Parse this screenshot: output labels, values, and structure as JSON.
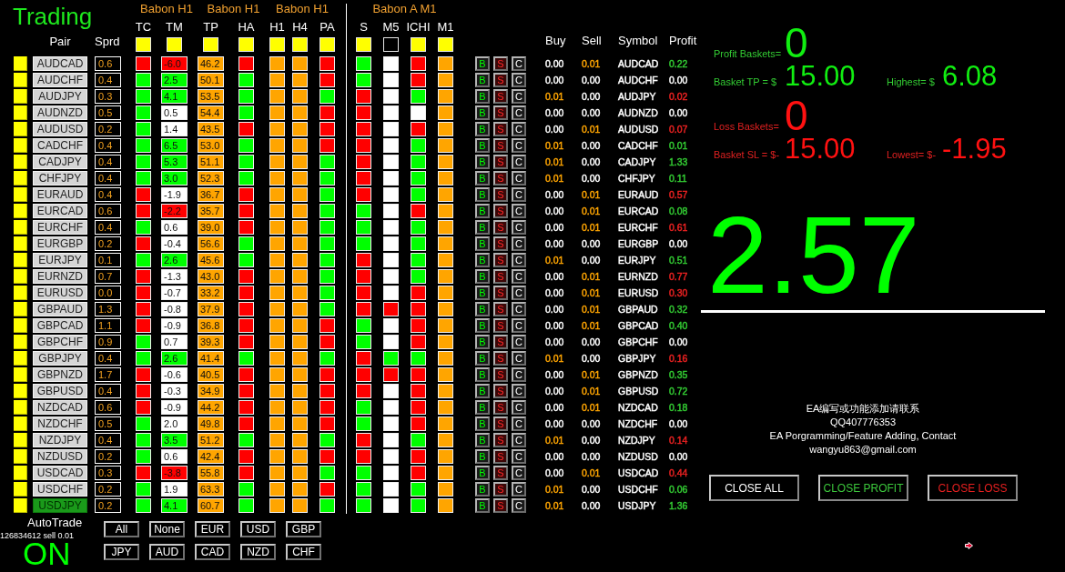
{
  "title": "Trading",
  "group_headers": [
    "Babon H1",
    "Babon H1",
    "Babon H1",
    "Babon A M1"
  ],
  "pair_header": "Pair",
  "spread_header": "Sprd",
  "columns": [
    {
      "label": "TC",
      "color": "#ffff00"
    },
    {
      "label": "TM",
      "color": "#ffff00"
    },
    {
      "label": "TP",
      "color": "#ffff00"
    },
    {
      "label": "HA",
      "color": "#ffff00"
    },
    {
      "label": "H1",
      "color": "#ffff00"
    },
    {
      "label": "H4",
      "color": "#ffff00"
    },
    {
      "label": "PA",
      "color": "#ffff00"
    },
    {
      "label": "S",
      "color": "#ffff00"
    },
    {
      "label": "M5",
      "color": "#000000"
    },
    {
      "label": "ICHI",
      "color": "#ffff00"
    },
    {
      "label": "M1",
      "color": "#ffff00"
    }
  ],
  "order_headers": [
    "Buy",
    "Sell",
    "Symbol",
    "Profit"
  ],
  "rows": [
    {
      "pair": "AUDCAD",
      "selected": false,
      "spread": "0.6",
      "tc": {
        "color": "#ff0000"
      },
      "tm": {
        "text": "-6.0",
        "color": "#ff0000"
      },
      "tp": "46.2",
      "ha": {
        "color": "#ff0000"
      },
      "h1": {
        "color": "#ffa500"
      },
      "h4": {
        "color": "#ffa500"
      },
      "pa": {
        "color": "#ff0000"
      },
      "s": {
        "color": "#00ff00"
      },
      "m5": {
        "color": "#ffffff"
      },
      "ichi": {
        "color": "#ff0000"
      },
      "m1": {
        "color": "#ffa500"
      },
      "buttons": [
        "B",
        "S",
        "C"
      ],
      "buy": {
        "text": "0.00",
        "color": "#ffffff"
      },
      "sell": {
        "text": "0.01",
        "color": "#ffa500"
      },
      "symbol": "AUDCAD",
      "profit": {
        "text": "0.22",
        "color": "#33cc33"
      }
    },
    {
      "pair": "AUDCHF",
      "selected": false,
      "spread": "0.4",
      "tc": {
        "color": "#00ff00"
      },
      "tm": {
        "text": "2.5",
        "color": "#00ff00"
      },
      "tp": "50.1",
      "ha": {
        "color": "#00ff00"
      },
      "h1": {
        "color": "#ffa500"
      },
      "h4": {
        "color": "#ffa500"
      },
      "pa": {
        "color": "#ff0000"
      },
      "s": {
        "color": "#00ff00"
      },
      "m5": {
        "color": "#ffffff"
      },
      "ichi": {
        "color": "#ff0000"
      },
      "m1": {
        "color": "#ffa500"
      },
      "buttons": [
        "B",
        "S",
        "C"
      ],
      "buy": {
        "text": "0.00",
        "color": "#ffffff"
      },
      "sell": {
        "text": "0.00",
        "color": "#ffffff"
      },
      "symbol": "AUDCHF",
      "profit": {
        "text": "0.00",
        "color": "#ffffff"
      }
    },
    {
      "pair": "AUDJPY",
      "selected": false,
      "spread": "0.3",
      "tc": {
        "color": "#00ff00"
      },
      "tm": {
        "text": "4.1",
        "color": "#00ff00"
      },
      "tp": "53.5",
      "ha": {
        "color": "#00ff00"
      },
      "h1": {
        "color": "#ffa500"
      },
      "h4": {
        "color": "#ffa500"
      },
      "pa": {
        "color": "#00ff00"
      },
      "s": {
        "color": "#ff0000"
      },
      "m5": {
        "color": "#ffffff"
      },
      "ichi": {
        "color": "#00ff00"
      },
      "m1": {
        "color": "#ffa500"
      },
      "buttons": [
        "B",
        "S",
        "C"
      ],
      "buy": {
        "text": "0.01",
        "color": "#ffa500"
      },
      "sell": {
        "text": "0.00",
        "color": "#ffffff"
      },
      "symbol": "AUDJPY",
      "profit": {
        "text": "0.02",
        "color": "#ee2222"
      }
    },
    {
      "pair": "AUDNZD",
      "selected": false,
      "spread": "0.5",
      "tc": {
        "color": "#00ff00"
      },
      "tm": {
        "text": "0.5",
        "color": "#ffffff"
      },
      "tp": "54.4",
      "ha": {
        "color": "#00ff00"
      },
      "h1": {
        "color": "#ffa500"
      },
      "h4": {
        "color": "#ffa500"
      },
      "pa": {
        "color": "#ff0000"
      },
      "s": {
        "color": "#ff0000"
      },
      "m5": {
        "color": "#ffffff"
      },
      "ichi": {
        "color": "#ffffff"
      },
      "m1": {
        "color": "#ffa500"
      },
      "buttons": [
        "B",
        "S",
        "C"
      ],
      "buy": {
        "text": "0.00",
        "color": "#ffffff"
      },
      "sell": {
        "text": "0.00",
        "color": "#ffffff"
      },
      "symbol": "AUDNZD",
      "profit": {
        "text": "0.00",
        "color": "#ffffff"
      }
    },
    {
      "pair": "AUDUSD",
      "selected": false,
      "spread": "0.2",
      "tc": {
        "color": "#00ff00"
      },
      "tm": {
        "text": "1.4",
        "color": "#ffffff"
      },
      "tp": "43.5",
      "ha": {
        "color": "#ff0000"
      },
      "h1": {
        "color": "#ffa500"
      },
      "h4": {
        "color": "#ffa500"
      },
      "pa": {
        "color": "#ff0000"
      },
      "s": {
        "color": "#ff0000"
      },
      "m5": {
        "color": "#ffffff"
      },
      "ichi": {
        "color": "#ff0000"
      },
      "m1": {
        "color": "#ffa500"
      },
      "buttons": [
        "B",
        "S",
        "C"
      ],
      "buy": {
        "text": "0.00",
        "color": "#ffffff"
      },
      "sell": {
        "text": "0.01",
        "color": "#ffa500"
      },
      "symbol": "AUDUSD",
      "profit": {
        "text": "0.07",
        "color": "#ee2222"
      }
    },
    {
      "pair": "CADCHF",
      "selected": false,
      "spread": "0.4",
      "tc": {
        "color": "#00ff00"
      },
      "tm": {
        "text": "6.5",
        "color": "#00ff00"
      },
      "tp": "53.0",
      "ha": {
        "color": "#00ff00"
      },
      "h1": {
        "color": "#ffa500"
      },
      "h4": {
        "color": "#ffa500"
      },
      "pa": {
        "color": "#ff0000"
      },
      "s": {
        "color": "#ff0000"
      },
      "m5": {
        "color": "#ffffff"
      },
      "ichi": {
        "color": "#00ff00"
      },
      "m1": {
        "color": "#ffa500"
      },
      "buttons": [
        "B",
        "S",
        "C"
      ],
      "buy": {
        "text": "0.01",
        "color": "#ffa500"
      },
      "sell": {
        "text": "0.00",
        "color": "#ffffff"
      },
      "symbol": "CADCHF",
      "profit": {
        "text": "0.01",
        "color": "#33cc33"
      }
    },
    {
      "pair": "CADJPY",
      "selected": false,
      "spread": "0.4",
      "tc": {
        "color": "#00ff00"
      },
      "tm": {
        "text": "5.3",
        "color": "#00ff00"
      },
      "tp": "51.1",
      "ha": {
        "color": "#00ff00"
      },
      "h1": {
        "color": "#ffa500"
      },
      "h4": {
        "color": "#ffa500"
      },
      "pa": {
        "color": "#00ff00"
      },
      "s": {
        "color": "#ff0000"
      },
      "m5": {
        "color": "#ffffff"
      },
      "ichi": {
        "color": "#00ff00"
      },
      "m1": {
        "color": "#ffa500"
      },
      "buttons": [
        "B",
        "S",
        "C"
      ],
      "buy": {
        "text": "0.01",
        "color": "#ffa500"
      },
      "sell": {
        "text": "0.00",
        "color": "#ffffff"
      },
      "symbol": "CADJPY",
      "profit": {
        "text": "1.33",
        "color": "#33cc33"
      }
    },
    {
      "pair": "CHFJPY",
      "selected": false,
      "spread": "0.4",
      "tc": {
        "color": "#00ff00"
      },
      "tm": {
        "text": "3.0",
        "color": "#00ff00"
      },
      "tp": "52.3",
      "ha": {
        "color": "#00ff00"
      },
      "h1": {
        "color": "#ffa500"
      },
      "h4": {
        "color": "#ffa500"
      },
      "pa": {
        "color": "#00ff00"
      },
      "s": {
        "color": "#ff0000"
      },
      "m5": {
        "color": "#ffffff"
      },
      "ichi": {
        "color": "#00ff00"
      },
      "m1": {
        "color": "#ffa500"
      },
      "buttons": [
        "B",
        "S",
        "C"
      ],
      "buy": {
        "text": "0.01",
        "color": "#ffa500"
      },
      "sell": {
        "text": "0.00",
        "color": "#ffffff"
      },
      "symbol": "CHFJPY",
      "profit": {
        "text": "0.11",
        "color": "#33cc33"
      }
    },
    {
      "pair": "EURAUD",
      "selected": false,
      "spread": "0.4",
      "tc": {
        "color": "#ff0000"
      },
      "tm": {
        "text": "-1.9",
        "color": "#ffffff"
      },
      "tp": "36.7",
      "ha": {
        "color": "#ff0000"
      },
      "h1": {
        "color": "#ffa500"
      },
      "h4": {
        "color": "#ffa500"
      },
      "pa": {
        "color": "#00ff00"
      },
      "s": {
        "color": "#ff0000"
      },
      "m5": {
        "color": "#ffffff"
      },
      "ichi": {
        "color": "#00ff00"
      },
      "m1": {
        "color": "#ffa500"
      },
      "buttons": [
        "B",
        "S",
        "C"
      ],
      "buy": {
        "text": "0.00",
        "color": "#ffffff"
      },
      "sell": {
        "text": "0.01",
        "color": "#ffa500"
      },
      "symbol": "EURAUD",
      "profit": {
        "text": "0.57",
        "color": "#ee2222"
      }
    },
    {
      "pair": "EURCAD",
      "selected": false,
      "spread": "0.6",
      "tc": {
        "color": "#ff0000"
      },
      "tm": {
        "text": "-2.2",
        "color": "#ff0000"
      },
      "tp": "35.7",
      "ha": {
        "color": "#ff0000"
      },
      "h1": {
        "color": "#ffa500"
      },
      "h4": {
        "color": "#ffa500"
      },
      "pa": {
        "color": "#00ff00"
      },
      "s": {
        "color": "#00ff00"
      },
      "m5": {
        "color": "#ffffff"
      },
      "ichi": {
        "color": "#ff0000"
      },
      "m1": {
        "color": "#ffa500"
      },
      "buttons": [
        "B",
        "S",
        "C"
      ],
      "buy": {
        "text": "0.00",
        "color": "#ffffff"
      },
      "sell": {
        "text": "0.01",
        "color": "#ffa500"
      },
      "symbol": "EURCAD",
      "profit": {
        "text": "0.08",
        "color": "#33cc33"
      }
    },
    {
      "pair": "EURCHF",
      "selected": false,
      "spread": "0.4",
      "tc": {
        "color": "#00ff00"
      },
      "tm": {
        "text": "0.6",
        "color": "#ffffff"
      },
      "tp": "39.0",
      "ha": {
        "color": "#ff0000"
      },
      "h1": {
        "color": "#ffa500"
      },
      "h4": {
        "color": "#ffa500"
      },
      "pa": {
        "color": "#00ff00"
      },
      "s": {
        "color": "#00ff00"
      },
      "m5": {
        "color": "#ffffff"
      },
      "ichi": {
        "color": "#00ff00"
      },
      "m1": {
        "color": "#ffa500"
      },
      "buttons": [
        "B",
        "S",
        "C"
      ],
      "buy": {
        "text": "0.00",
        "color": "#ffffff"
      },
      "sell": {
        "text": "0.01",
        "color": "#ffa500"
      },
      "symbol": "EURCHF",
      "profit": {
        "text": "0.61",
        "color": "#ee2222"
      }
    },
    {
      "pair": "EURGBP",
      "selected": false,
      "spread": "0.2",
      "tc": {
        "color": "#ff0000"
      },
      "tm": {
        "text": "-0.4",
        "color": "#ffffff"
      },
      "tp": "56.6",
      "ha": {
        "color": "#00ff00"
      },
      "h1": {
        "color": "#ffa500"
      },
      "h4": {
        "color": "#ffa500"
      },
      "pa": {
        "color": "#00ff00"
      },
      "s": {
        "color": "#00ff00"
      },
      "m5": {
        "color": "#ffffff"
      },
      "ichi": {
        "color": "#00ff00"
      },
      "m1": {
        "color": "#ffa500"
      },
      "buttons": [
        "B",
        "S",
        "C"
      ],
      "buy": {
        "text": "0.00",
        "color": "#ffffff"
      },
      "sell": {
        "text": "0.00",
        "color": "#ffffff"
      },
      "symbol": "EURGBP",
      "profit": {
        "text": "0.00",
        "color": "#ffffff"
      }
    },
    {
      "pair": "EURJPY",
      "selected": false,
      "spread": "0.1",
      "tc": {
        "color": "#00ff00"
      },
      "tm": {
        "text": "2.6",
        "color": "#00ff00"
      },
      "tp": "45.6",
      "ha": {
        "color": "#00ff00"
      },
      "h1": {
        "color": "#ffa500"
      },
      "h4": {
        "color": "#ffa500"
      },
      "pa": {
        "color": "#00ff00"
      },
      "s": {
        "color": "#ff0000"
      },
      "m5": {
        "color": "#ffffff"
      },
      "ichi": {
        "color": "#00ff00"
      },
      "m1": {
        "color": "#ffa500"
      },
      "buttons": [
        "B",
        "S",
        "C"
      ],
      "buy": {
        "text": "0.01",
        "color": "#ffa500"
      },
      "sell": {
        "text": "0.00",
        "color": "#ffffff"
      },
      "symbol": "EURJPY",
      "profit": {
        "text": "0.51",
        "color": "#33cc33"
      }
    },
    {
      "pair": "EURNZD",
      "selected": false,
      "spread": "0.7",
      "tc": {
        "color": "#ff0000"
      },
      "tm": {
        "text": "-1.3",
        "color": "#ffffff"
      },
      "tp": "43.0",
      "ha": {
        "color": "#ff0000"
      },
      "h1": {
        "color": "#ffa500"
      },
      "h4": {
        "color": "#ffa500"
      },
      "pa": {
        "color": "#00ff00"
      },
      "s": {
        "color": "#ff0000"
      },
      "m5": {
        "color": "#ffffff"
      },
      "ichi": {
        "color": "#00ff00"
      },
      "m1": {
        "color": "#ffa500"
      },
      "buttons": [
        "B",
        "S",
        "C"
      ],
      "buy": {
        "text": "0.00",
        "color": "#ffffff"
      },
      "sell": {
        "text": "0.01",
        "color": "#ffa500"
      },
      "symbol": "EURNZD",
      "profit": {
        "text": "0.77",
        "color": "#ee2222"
      }
    },
    {
      "pair": "EURUSD",
      "selected": false,
      "spread": "0.0",
      "tc": {
        "color": "#ff0000"
      },
      "tm": {
        "text": "-0.7",
        "color": "#ffffff"
      },
      "tp": "33.2",
      "ha": {
        "color": "#ff0000"
      },
      "h1": {
        "color": "#ffa500"
      },
      "h4": {
        "color": "#ffa500"
      },
      "pa": {
        "color": "#00ff00"
      },
      "s": {
        "color": "#ff0000"
      },
      "m5": {
        "color": "#ffffff"
      },
      "ichi": {
        "color": "#ff0000"
      },
      "m1": {
        "color": "#ffa500"
      },
      "buttons": [
        "B",
        "S",
        "C"
      ],
      "buy": {
        "text": "0.00",
        "color": "#ffffff"
      },
      "sell": {
        "text": "0.01",
        "color": "#ffa500"
      },
      "symbol": "EURUSD",
      "profit": {
        "text": "0.30",
        "color": "#ee2222"
      }
    },
    {
      "pair": "GBPAUD",
      "selected": false,
      "spread": "1.3",
      "tc": {
        "color": "#ff0000"
      },
      "tm": {
        "text": "-0.8",
        "color": "#ffffff"
      },
      "tp": "37.9",
      "ha": {
        "color": "#ff0000"
      },
      "h1": {
        "color": "#ffa500"
      },
      "h4": {
        "color": "#ffa500"
      },
      "pa": {
        "color": "#00ff00"
      },
      "s": {
        "color": "#ff0000"
      },
      "m5": {
        "color": "#ff0000"
      },
      "ichi": {
        "color": "#ff0000"
      },
      "m1": {
        "color": "#ffa500"
      },
      "buttons": [
        "B",
        "S",
        "C"
      ],
      "buy": {
        "text": "0.00",
        "color": "#ffffff"
      },
      "sell": {
        "text": "0.01",
        "color": "#ffa500"
      },
      "symbol": "GBPAUD",
      "profit": {
        "text": "0.32",
        "color": "#33cc33"
      }
    },
    {
      "pair": "GBPCAD",
      "selected": false,
      "spread": "1.1",
      "tc": {
        "color": "#ff0000"
      },
      "tm": {
        "text": "-0.9",
        "color": "#ffffff"
      },
      "tp": "36.8",
      "ha": {
        "color": "#ff0000"
      },
      "h1": {
        "color": "#ffa500"
      },
      "h4": {
        "color": "#ffa500"
      },
      "pa": {
        "color": "#ff0000"
      },
      "s": {
        "color": "#00ff00"
      },
      "m5": {
        "color": "#ffffff"
      },
      "ichi": {
        "color": "#ff0000"
      },
      "m1": {
        "color": "#ffa500"
      },
      "buttons": [
        "B",
        "S",
        "C"
      ],
      "buy": {
        "text": "0.00",
        "color": "#ffffff"
      },
      "sell": {
        "text": "0.01",
        "color": "#ffa500"
      },
      "symbol": "GBPCAD",
      "profit": {
        "text": "0.40",
        "color": "#33cc33"
      }
    },
    {
      "pair": "GBPCHF",
      "selected": false,
      "spread": "0.9",
      "tc": {
        "color": "#00ff00"
      },
      "tm": {
        "text": "0.7",
        "color": "#ffffff"
      },
      "tp": "39.3",
      "ha": {
        "color": "#ff0000"
      },
      "h1": {
        "color": "#ffa500"
      },
      "h4": {
        "color": "#ffa500"
      },
      "pa": {
        "color": "#ff0000"
      },
      "s": {
        "color": "#00ff00"
      },
      "m5": {
        "color": "#ffffff"
      },
      "ichi": {
        "color": "#ff0000"
      },
      "m1": {
        "color": "#ffa500"
      },
      "buttons": [
        "B",
        "S",
        "C"
      ],
      "buy": {
        "text": "0.00",
        "color": "#ffffff"
      },
      "sell": {
        "text": "0.00",
        "color": "#ffffff"
      },
      "symbol": "GBPCHF",
      "profit": {
        "text": "0.00",
        "color": "#ffffff"
      }
    },
    {
      "pair": "GBPJPY",
      "selected": false,
      "spread": "0.4",
      "tc": {
        "color": "#00ff00"
      },
      "tm": {
        "text": "2.6",
        "color": "#00ff00"
      },
      "tp": "41.4",
      "ha": {
        "color": "#00ff00"
      },
      "h1": {
        "color": "#ffa500"
      },
      "h4": {
        "color": "#ffa500"
      },
      "pa": {
        "color": "#00ff00"
      },
      "s": {
        "color": "#ff0000"
      },
      "m5": {
        "color": "#00ff00"
      },
      "ichi": {
        "color": "#00ff00"
      },
      "m1": {
        "color": "#ffa500"
      },
      "buttons": [
        "B",
        "S",
        "C"
      ],
      "buy": {
        "text": "0.01",
        "color": "#ffa500"
      },
      "sell": {
        "text": "0.00",
        "color": "#ffffff"
      },
      "symbol": "GBPJPY",
      "profit": {
        "text": "0.16",
        "color": "#ee2222"
      }
    },
    {
      "pair": "GBPNZD",
      "selected": false,
      "spread": "1.7",
      "tc": {
        "color": "#ff0000"
      },
      "tm": {
        "text": "-0.6",
        "color": "#ffffff"
      },
      "tp": "40.5",
      "ha": {
        "color": "#ff0000"
      },
      "h1": {
        "color": "#ffa500"
      },
      "h4": {
        "color": "#ffa500"
      },
      "pa": {
        "color": "#ff0000"
      },
      "s": {
        "color": "#ff0000"
      },
      "m5": {
        "color": "#ff0000"
      },
      "ichi": {
        "color": "#ff0000"
      },
      "m1": {
        "color": "#ffa500"
      },
      "buttons": [
        "B",
        "S",
        "C"
      ],
      "buy": {
        "text": "0.00",
        "color": "#ffffff"
      },
      "sell": {
        "text": "0.01",
        "color": "#ffa500"
      },
      "symbol": "GBPNZD",
      "profit": {
        "text": "0.35",
        "color": "#33cc33"
      }
    },
    {
      "pair": "GBPUSD",
      "selected": false,
      "spread": "0.4",
      "tc": {
        "color": "#ff0000"
      },
      "tm": {
        "text": "-0.3",
        "color": "#ffffff"
      },
      "tp": "34.9",
      "ha": {
        "color": "#ff0000"
      },
      "h1": {
        "color": "#ffa500"
      },
      "h4": {
        "color": "#ffa500"
      },
      "pa": {
        "color": "#ff0000"
      },
      "s": {
        "color": "#ff0000"
      },
      "m5": {
        "color": "#ffffff"
      },
      "ichi": {
        "color": "#ff0000"
      },
      "m1": {
        "color": "#ffa500"
      },
      "buttons": [
        "B",
        "S",
        "C"
      ],
      "buy": {
        "text": "0.00",
        "color": "#ffffff"
      },
      "sell": {
        "text": "0.01",
        "color": "#ffa500"
      },
      "symbol": "GBPUSD",
      "profit": {
        "text": "0.72",
        "color": "#33cc33"
      }
    },
    {
      "pair": "NZDCAD",
      "selected": false,
      "spread": "0.6",
      "tc": {
        "color": "#ff0000"
      },
      "tm": {
        "text": "-0.9",
        "color": "#ffffff"
      },
      "tp": "44.2",
      "ha": {
        "color": "#ff0000"
      },
      "h1": {
        "color": "#ffa500"
      },
      "h4": {
        "color": "#ffa500"
      },
      "pa": {
        "color": "#ff0000"
      },
      "s": {
        "color": "#00ff00"
      },
      "m5": {
        "color": "#ffffff"
      },
      "ichi": {
        "color": "#ff0000"
      },
      "m1": {
        "color": "#ffa500"
      },
      "buttons": [
        "B",
        "S",
        "C"
      ],
      "buy": {
        "text": "0.00",
        "color": "#ffffff"
      },
      "sell": {
        "text": "0.01",
        "color": "#ffa500"
      },
      "symbol": "NZDCAD",
      "profit": {
        "text": "0.18",
        "color": "#33cc33"
      }
    },
    {
      "pair": "NZDCHF",
      "selected": false,
      "spread": "0.5",
      "tc": {
        "color": "#00ff00"
      },
      "tm": {
        "text": "2.0",
        "color": "#ffffff"
      },
      "tp": "49.8",
      "ha": {
        "color": "#ff0000"
      },
      "h1": {
        "color": "#ffa500"
      },
      "h4": {
        "color": "#ffa500"
      },
      "pa": {
        "color": "#ff0000"
      },
      "s": {
        "color": "#00ff00"
      },
      "m5": {
        "color": "#ffffff"
      },
      "ichi": {
        "color": "#ff0000"
      },
      "m1": {
        "color": "#ffa500"
      },
      "buttons": [
        "B",
        "S",
        "C"
      ],
      "buy": {
        "text": "0.00",
        "color": "#ffffff"
      },
      "sell": {
        "text": "0.00",
        "color": "#ffffff"
      },
      "symbol": "NZDCHF",
      "profit": {
        "text": "0.00",
        "color": "#ffffff"
      }
    },
    {
      "pair": "NZDJPY",
      "selected": false,
      "spread": "0.4",
      "tc": {
        "color": "#00ff00"
      },
      "tm": {
        "text": "3.5",
        "color": "#00ff00"
      },
      "tp": "51.2",
      "ha": {
        "color": "#00ff00"
      },
      "h1": {
        "color": "#ffa500"
      },
      "h4": {
        "color": "#ffa500"
      },
      "pa": {
        "color": "#00ff00"
      },
      "s": {
        "color": "#ff0000"
      },
      "m5": {
        "color": "#ffffff"
      },
      "ichi": {
        "color": "#00ff00"
      },
      "m1": {
        "color": "#ffa500"
      },
      "buttons": [
        "B",
        "S",
        "C"
      ],
      "buy": {
        "text": "0.01",
        "color": "#ffa500"
      },
      "sell": {
        "text": "0.00",
        "color": "#ffffff"
      },
      "symbol": "NZDJPY",
      "profit": {
        "text": "0.14",
        "color": "#ee2222"
      }
    },
    {
      "pair": "NZDUSD",
      "selected": false,
      "spread": "0.2",
      "tc": {
        "color": "#00ff00"
      },
      "tm": {
        "text": "0.6",
        "color": "#ffffff"
      },
      "tp": "42.4",
      "ha": {
        "color": "#ff0000"
      },
      "h1": {
        "color": "#ffa500"
      },
      "h4": {
        "color": "#ffa500"
      },
      "pa": {
        "color": "#ff0000"
      },
      "s": {
        "color": "#ff0000"
      },
      "m5": {
        "color": "#ffffff"
      },
      "ichi": {
        "color": "#ff0000"
      },
      "m1": {
        "color": "#ffa500"
      },
      "buttons": [
        "B",
        "S",
        "C"
      ],
      "buy": {
        "text": "0.00",
        "color": "#ffffff"
      },
      "sell": {
        "text": "0.00",
        "color": "#ffffff"
      },
      "symbol": "NZDUSD",
      "profit": {
        "text": "0.00",
        "color": "#ffffff"
      }
    },
    {
      "pair": "USDCAD",
      "selected": false,
      "spread": "0.3",
      "tc": {
        "color": "#ff0000"
      },
      "tm": {
        "text": "-3.8",
        "color": "#ff0000"
      },
      "tp": "55.8",
      "ha": {
        "color": "#ff0000"
      },
      "h1": {
        "color": "#ffa500"
      },
      "h4": {
        "color": "#ffa500"
      },
      "pa": {
        "color": "#00ff00"
      },
      "s": {
        "color": "#00ff00"
      },
      "m5": {
        "color": "#ffffff"
      },
      "ichi": {
        "color": "#ff0000"
      },
      "m1": {
        "color": "#ffa500"
      },
      "buttons": [
        "B",
        "S",
        "C"
      ],
      "buy": {
        "text": "0.00",
        "color": "#ffffff"
      },
      "sell": {
        "text": "0.01",
        "color": "#ffa500"
      },
      "symbol": "USDCAD",
      "profit": {
        "text": "0.44",
        "color": "#ee2222"
      }
    },
    {
      "pair": "USDCHF",
      "selected": false,
      "spread": "0.2",
      "tc": {
        "color": "#00ff00"
      },
      "tm": {
        "text": "1.9",
        "color": "#ffffff"
      },
      "tp": "63.3",
      "ha": {
        "color": "#00ff00"
      },
      "h1": {
        "color": "#ffa500"
      },
      "h4": {
        "color": "#ffa500"
      },
      "pa": {
        "color": "#ff0000"
      },
      "s": {
        "color": "#00ff00"
      },
      "m5": {
        "color": "#ffffff"
      },
      "ichi": {
        "color": "#00ff00"
      },
      "m1": {
        "color": "#ffa500"
      },
      "buttons": [
        "B",
        "S",
        "C"
      ],
      "buy": {
        "text": "0.01",
        "color": "#ffa500"
      },
      "sell": {
        "text": "0.00",
        "color": "#ffffff"
      },
      "symbol": "USDCHF",
      "profit": {
        "text": "0.06",
        "color": "#33cc33"
      }
    },
    {
      "pair": "USDJPY",
      "selected": true,
      "spread": "0.2",
      "tc": {
        "color": "#00ff00"
      },
      "tm": {
        "text": "4.1",
        "color": "#00ff00"
      },
      "tp": "60.7",
      "ha": {
        "color": "#00ff00"
      },
      "h1": {
        "color": "#ffa500"
      },
      "h4": {
        "color": "#ffa500"
      },
      "pa": {
        "color": "#00ff00"
      },
      "s": {
        "color": "#00ff00"
      },
      "m5": {
        "color": "#ffffff"
      },
      "ichi": {
        "color": "#00ff00"
      },
      "m1": {
        "color": "#ffa500"
      },
      "buttons": [
        "B",
        "S",
        "C"
      ],
      "buy": {
        "text": "0.01",
        "color": "#ffa500"
      },
      "sell": {
        "text": "0.00",
        "color": "#ffffff"
      },
      "symbol": "USDJPY",
      "profit": {
        "text": "1.36",
        "color": "#33cc33"
      }
    }
  ],
  "autotrade": {
    "label": "AutoTrade",
    "on": true,
    "status": "ON"
  },
  "last_order": "126834612 sell 0.01",
  "filter_buttons": [
    "All",
    "None",
    "EUR",
    "USD",
    "GBP",
    "JPY",
    "AUD",
    "CAD",
    "NZD",
    "CHF"
  ],
  "baskets": [
    {
      "kind": "profit",
      "count_label": "Profit Baskets=",
      "count": "0",
      "target_label": "Basket TP = $",
      "target": "15.00",
      "extreme_label": "Highest= $",
      "extreme": "6.08"
    },
    {
      "kind": "loss",
      "count_label": "Loss Baskets=",
      "count": "0",
      "target_label": "Basket SL = $-",
      "target": "15.00",
      "extreme_label": "Lowest= $-",
      "extreme": "-1.95"
    }
  ],
  "total_profit": "2.57",
  "contact": [
    "EA编写或功能添加请联系",
    "QQ407776353",
    "EA Porgramming/Feature Adding, Contact",
    "wangyu863@gmail.com"
  ],
  "close_buttons": [
    {
      "kind": "all",
      "label": "CLOSE ALL"
    },
    {
      "kind": "profit",
      "label": "CLOSE PROFIT"
    },
    {
      "kind": "loss",
      "label": "CLOSE LOSS"
    }
  ]
}
